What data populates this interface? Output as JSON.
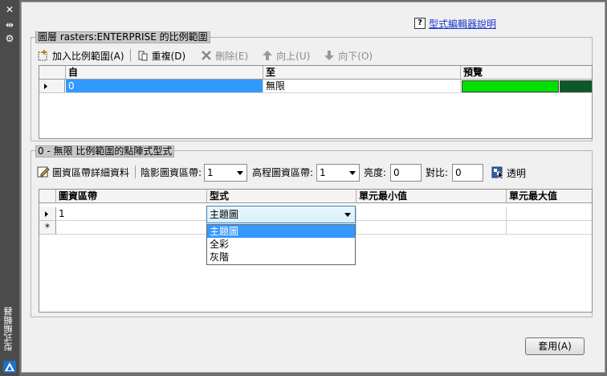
{
  "palette": {
    "close_symbol": "✕",
    "autohide_symbol": "⇹",
    "properties_symbol": "⚙",
    "title": "型式編輯器"
  },
  "help_link": {
    "label": "型式編輯器說明"
  },
  "scale_section": {
    "title": "圖層 rasters:ENTERPRISE 的比例範圍",
    "toolbar": {
      "add_label": "加入比例範圍(A)",
      "duplicate_label": "重複(D)",
      "delete_label": "刪除(E)",
      "up_label": "向上(U)",
      "down_label": "向下(O)"
    },
    "grid": {
      "headers": [
        "自",
        "至",
        "預覽"
      ],
      "rows": [
        {
          "from": "0",
          "to": "無限"
        }
      ],
      "preview_colors": [
        "#00e000",
        "#0a5a2a"
      ]
    }
  },
  "style_section": {
    "title": "0 - 無限 比例範圍的點陣式型式",
    "toolbar": {
      "band_details_label": "圖資區帶詳細資料",
      "hillshade_label": "陰影圖資區帶:",
      "hillshade_value": "1",
      "elevation_label": "高程圖資區帶:",
      "elevation_value": "1",
      "brightness_label": "亮度:",
      "brightness_value": "0",
      "contrast_label": "對比:",
      "contrast_value": "0",
      "transparency_label": "透明"
    },
    "grid": {
      "headers": [
        "圖資區帶",
        "型式",
        "單元最小值",
        "單元最大值"
      ],
      "rows": [
        {
          "band": "1",
          "style": "主題圖"
        }
      ],
      "new_row_marker": "*",
      "dropdown": {
        "options": [
          "主題圖",
          "全彩",
          "灰階"
        ],
        "selected": "主題圖"
      }
    }
  },
  "apply_button": {
    "label": "套用(A)"
  },
  "colors": {
    "selection": "#3399ff",
    "link": "#1a35c9"
  }
}
